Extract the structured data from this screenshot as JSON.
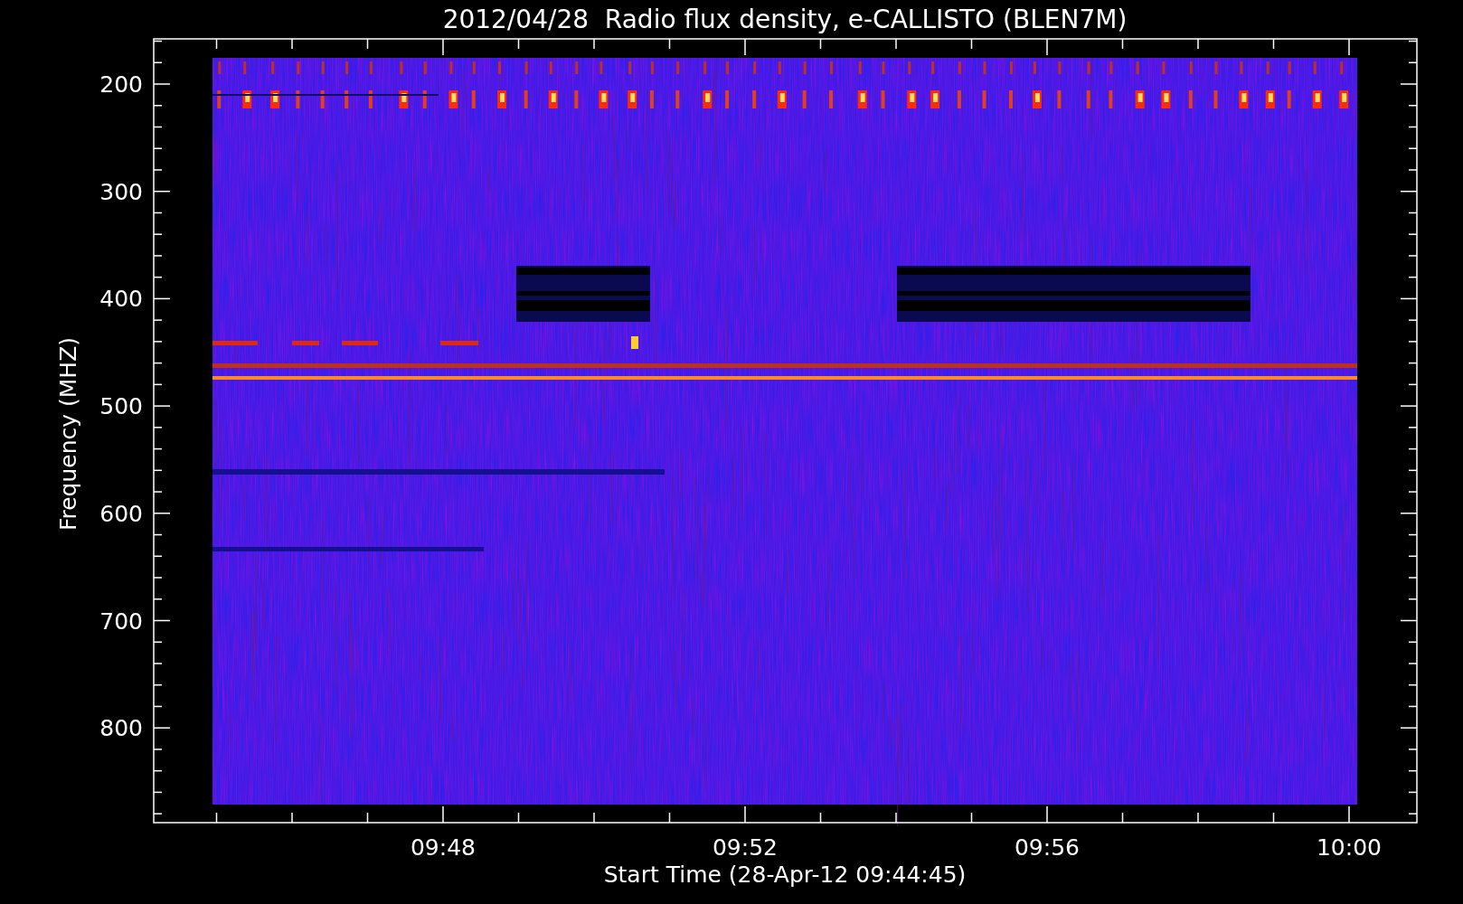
{
  "title": "2012/04/28  Radio flux density, e-CALLISTO (BLEN7M)",
  "y_axis": {
    "label": "Frequency (MHZ)",
    "ticks": [
      "200",
      "300",
      "400",
      "500",
      "600",
      "700",
      "800"
    ]
  },
  "x_axis": {
    "label": "Start Time (28-Apr-12 09:44:45)",
    "ticks": [
      "09:48",
      "09:52",
      "09:56",
      "10:00"
    ]
  }
}
